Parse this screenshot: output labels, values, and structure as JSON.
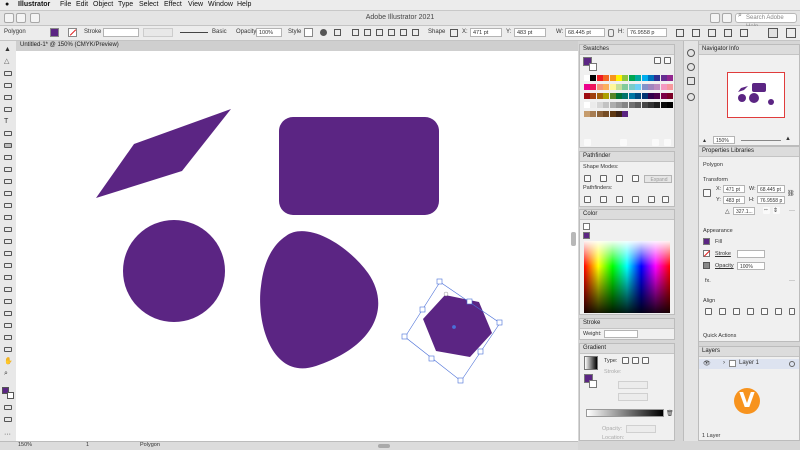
{
  "menubar": {
    "app_name": "Illustrator",
    "items": [
      "File",
      "Edit",
      "Object",
      "Type",
      "Select",
      "Effect",
      "View",
      "Window",
      "Help"
    ]
  },
  "titlebar": {
    "title": "Adobe Illustrator 2021",
    "search_placeholder": "Search Adobe Help"
  },
  "controlbar": {
    "selection_label": "Polygon",
    "stroke_label": "Stroke",
    "brush_label": "Basic",
    "opacity_label": "Opacity",
    "opacity_value": "100%",
    "style_label": "Style",
    "shape_label": "Shape",
    "x_label": "X:",
    "x_value": "471 pt",
    "y_label": "Y:",
    "y_value": "483 pt",
    "w_label": "W:",
    "w_value": "68.445 pt",
    "h_label": "H:",
    "h_value": "76.9558 p"
  },
  "document": {
    "tab_title": "Untitled-1* @ 150% (CMYK/Preview)"
  },
  "statusbar": {
    "zoom": "150%",
    "page": "1",
    "tool_name": "Polygon"
  },
  "colors": {
    "shape_fill": "#5b2583",
    "selection": "#4a6fd8"
  },
  "swatches_panel": {
    "title": "Swatches"
  },
  "pathfinder_panel": {
    "title": "Pathfinder",
    "shape_modes_label": "Shape Modes:",
    "expand_label": "Expand",
    "pathfinders_label": "Pathfinders:"
  },
  "color_panel": {
    "title": "Color"
  },
  "stroke_panel": {
    "title": "Stroke",
    "weight_label": "Weight:"
  },
  "gradient_panel": {
    "title": "Gradient",
    "type_label": "Type:",
    "stroke_label": "Stroke:",
    "opacity_label": "Opacity:",
    "location_label": "Location:"
  },
  "navigator_panel": {
    "tabs": [
      "Navigator",
      "Info"
    ],
    "zoom": "150%"
  },
  "properties_panel": {
    "tabs": [
      "Properties",
      "Libraries"
    ],
    "object_type": "Polygon",
    "transform_label": "Transform",
    "x_label": "X:",
    "x_value": "471 pt",
    "y_label": "Y:",
    "y_value": "483 pt",
    "w_label": "W:",
    "w_value": "68.445 pt",
    "h_label": "H:",
    "h_value": "76.9558 p",
    "rotate_value": "327.1...",
    "appearance_label": "Appearance",
    "fill_label": "Fill",
    "stroke_label": "Stroke",
    "opacity_label": "Opacity",
    "opacity_value": "100%",
    "fx_label": "fx.",
    "align_label": "Align",
    "quick_actions_label": "Quick Actions"
  },
  "layers_panel": {
    "title": "Layers",
    "layer_name": "Layer 1",
    "footer": "1 Layer"
  }
}
